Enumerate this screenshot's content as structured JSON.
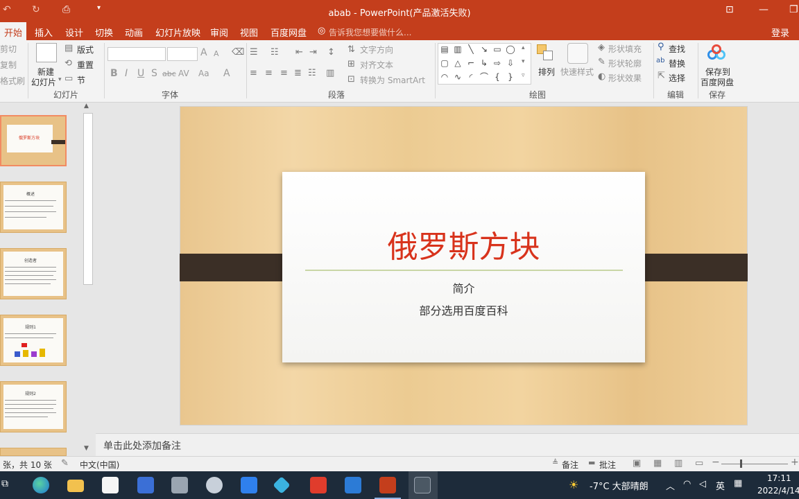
{
  "titlebar": {
    "title": "abab - PowerPoint(产品激活失败)",
    "quick_access": [
      "↶",
      "↻",
      "⎙",
      "▾"
    ],
    "window_controls": [
      "⊡",
      "—",
      "❐"
    ]
  },
  "tabs": {
    "active": "开始",
    "items": [
      "插入",
      "设计",
      "切换",
      "动画",
      "幻灯片放映",
      "审阅",
      "视图",
      "百度网盘"
    ],
    "tell_me": "告诉我您想要做什么...",
    "login": "登录"
  },
  "ribbon": {
    "clipboard": {
      "cut": "剪切",
      "copy": "复制",
      "format_painter": "格式刷"
    },
    "slides": {
      "new_slide_line1": "新建",
      "new_slide_line2": "幻灯片",
      "layout": "版式",
      "reset": "重置",
      "section": "节",
      "group": "幻灯片"
    },
    "font": {
      "group": "字体",
      "bold": "B",
      "italic": "I",
      "underline": "U",
      "shadow": "S",
      "strike": "abc",
      "spacing": "AV",
      "case": "Aa",
      "color": "A",
      "grow": "A",
      "shrink": "A"
    },
    "paragraph": {
      "group": "段落",
      "text_direction": "文字方向",
      "align_text": "对齐文本",
      "smartart": "转换为 SmartArt"
    },
    "drawing": {
      "group": "绘图",
      "arrange": "排列",
      "quick_styles": "快速样式",
      "shape_fill": "形状填充",
      "shape_outline": "形状轮廓",
      "shape_effects": "形状效果"
    },
    "editing": {
      "group": "编辑",
      "find": "查找",
      "replace": "替换",
      "select": "选择"
    },
    "save": {
      "group": "保存",
      "line1": "保存到",
      "line2": "百度网盘"
    }
  },
  "thumbnails": [
    {
      "num": "1",
      "title": "俄罗斯方块",
      "selected": true
    },
    {
      "num": "2",
      "title": "概述"
    },
    {
      "num": "3",
      "title": "创造者"
    },
    {
      "num": "4",
      "title": "规则1"
    },
    {
      "num": "5",
      "title": "规则2"
    }
  ],
  "slide": {
    "title": "俄罗斯方块",
    "subtitle1": "简介",
    "subtitle2": "部分选用百度百科",
    "title_color": "#d8331c"
  },
  "notes_placeholder": "单击此处添加备注",
  "status": {
    "slide_info": "张，共 10 张",
    "language": "中文(中国)",
    "notes": "备注",
    "comments": "批注"
  },
  "tray": {
    "weather": "-7°C 大部晴朗",
    "ime": "英",
    "time": "17:11",
    "date": "2022/4/14"
  },
  "colors": {
    "accent": "#c43e1c",
    "taskbar": "#1d2b3a"
  }
}
